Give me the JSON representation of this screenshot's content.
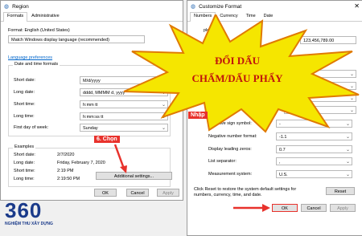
{
  "region": {
    "title": "Region",
    "tabs": [
      "Formats",
      "Administrative"
    ],
    "format_label": "Format: English (United States)",
    "format_value": "Match Windows display language (recommended)",
    "language_prefs_link": "Language preferences",
    "date_time_group": "Date and time formats",
    "short_date_label": "Short date:",
    "short_date_value": "M/d/yyyy",
    "long_date_label": "Long date:",
    "long_date_value": "dddd, MMMM d, yyyy",
    "short_time_label": "Short time:",
    "short_time_value": "h:mm tt",
    "long_time_label": "Long time:",
    "long_time_value": "h:mm:ss tt",
    "first_day_label": "First day of week:",
    "first_day_value": "Sunday",
    "examples_title": "Examples",
    "examples": [
      {
        "label": "Short date:",
        "value": "2/7/2020"
      },
      {
        "label": "Long date:",
        "value": "Friday, February 7, 2020"
      },
      {
        "label": "Short time:",
        "value": "2:19 PM"
      },
      {
        "label": "Long time:",
        "value": "2:19:50 PM"
      }
    ],
    "additional_settings": "Additional settings...",
    "ok": "OK",
    "cancel": "Cancel",
    "apply": "Apply"
  },
  "custom": {
    "title": "Customize Format",
    "tabs": [
      "Numbers",
      "Currency",
      "Time",
      "Date"
    ],
    "example_label": "ple",
    "positive_value": "123,456,789.00",
    "negative_sign_label": "Negative sign symbol:",
    "negative_sign_value": "-",
    "negative_number_label": "Negative number format:",
    "negative_number_value": "-1.1",
    "leading_zeros_label": "Display leading zeros:",
    "leading_zeros_value": "0.7",
    "list_separator_label": "List separator:",
    "list_separator_value": ",",
    "measurement_label": "Measurement system:",
    "measurement_value": "U.S.",
    "reset_info": "Click Reset to restore the system default settings for numbers, currency, time, and date.",
    "reset": "Reset",
    "ok": "OK",
    "cancel": "Cancel",
    "apply": "Apply"
  },
  "overlay": {
    "star_line1": "ĐỔI DẤU",
    "star_line2": "CHẤM/DẤU PHẨY",
    "step_callout": "6. Chọn",
    "nhap_callout": "Nhập",
    "logo_text": "360",
    "logo_tagline": "NGHIỆM THU XÂY DỰNG"
  },
  "colors": {
    "accent": "#e8322c",
    "star": "#f5e600",
    "star_text": "#c0140c",
    "link": "#0066cc",
    "logo_blue": "#1a3a8a"
  }
}
